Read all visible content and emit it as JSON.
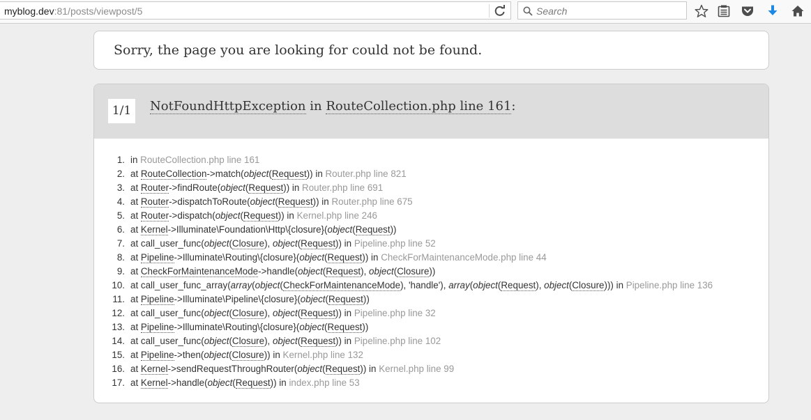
{
  "browser": {
    "url_host": "myblog.dev",
    "url_rest": ":81/posts/viewpost/5",
    "search_placeholder": "Search",
    "icons": [
      "reload-icon",
      "search-icon",
      "bookmark-star-icon",
      "reading-list-icon",
      "pocket-icon",
      "download-icon",
      "home-icon"
    ],
    "colors": {
      "download": "#1e88e5",
      "icon": "#4d4d4d"
    }
  },
  "page": {
    "message": "Sorry, the page you are looking for could not be found.",
    "exception": {
      "counter": "1/1",
      "class_name": "NotFoundHttpException",
      "in_word": " in ",
      "location": "RouteCollection.php line 161",
      "suffix": ":"
    },
    "trace": [
      {
        "n": "1.",
        "parts": [
          {
            "t": "in "
          },
          {
            "t": "RouteCollection.php line 161",
            "c": "loc"
          }
        ]
      },
      {
        "n": "2.",
        "parts": [
          {
            "t": "at "
          },
          {
            "t": "RouteCollection",
            "c": "ab"
          },
          {
            "t": "->match("
          },
          {
            "t": "object",
            "c": "it"
          },
          {
            "t": "("
          },
          {
            "t": "Request",
            "c": "ab"
          },
          {
            "t": ")) in "
          },
          {
            "t": "Router.php line 821",
            "c": "loc"
          }
        ]
      },
      {
        "n": "3.",
        "parts": [
          {
            "t": "at "
          },
          {
            "t": "Router",
            "c": "ab"
          },
          {
            "t": "->findRoute("
          },
          {
            "t": "object",
            "c": "it"
          },
          {
            "t": "("
          },
          {
            "t": "Request",
            "c": "ab"
          },
          {
            "t": ")) in "
          },
          {
            "t": "Router.php line 691",
            "c": "loc"
          }
        ]
      },
      {
        "n": "4.",
        "parts": [
          {
            "t": "at "
          },
          {
            "t": "Router",
            "c": "ab"
          },
          {
            "t": "->dispatchToRoute("
          },
          {
            "t": "object",
            "c": "it"
          },
          {
            "t": "("
          },
          {
            "t": "Request",
            "c": "ab"
          },
          {
            "t": ")) in "
          },
          {
            "t": "Router.php line 675",
            "c": "loc"
          }
        ]
      },
      {
        "n": "5.",
        "parts": [
          {
            "t": "at "
          },
          {
            "t": "Router",
            "c": "ab"
          },
          {
            "t": "->dispatch("
          },
          {
            "t": "object",
            "c": "it"
          },
          {
            "t": "("
          },
          {
            "t": "Request",
            "c": "ab"
          },
          {
            "t": ")) in "
          },
          {
            "t": "Kernel.php line 246",
            "c": "loc"
          }
        ]
      },
      {
        "n": "6.",
        "parts": [
          {
            "t": "at "
          },
          {
            "t": "Kernel",
            "c": "ab"
          },
          {
            "t": "->Illuminate\\Foundation\\Http\\{closure}("
          },
          {
            "t": "object",
            "c": "it"
          },
          {
            "t": "("
          },
          {
            "t": "Request",
            "c": "ab"
          },
          {
            "t": "))"
          }
        ]
      },
      {
        "n": "7.",
        "parts": [
          {
            "t": "at call_user_func("
          },
          {
            "t": "object",
            "c": "it"
          },
          {
            "t": "("
          },
          {
            "t": "Closure",
            "c": "ab"
          },
          {
            "t": "), "
          },
          {
            "t": "object",
            "c": "it"
          },
          {
            "t": "("
          },
          {
            "t": "Request",
            "c": "ab"
          },
          {
            "t": ")) in "
          },
          {
            "t": "Pipeline.php line 52",
            "c": "loc"
          }
        ]
      },
      {
        "n": "8.",
        "parts": [
          {
            "t": "at "
          },
          {
            "t": "Pipeline",
            "c": "ab"
          },
          {
            "t": "->Illuminate\\Routing\\{closure}("
          },
          {
            "t": "object",
            "c": "it"
          },
          {
            "t": "("
          },
          {
            "t": "Request",
            "c": "ab"
          },
          {
            "t": ")) in "
          },
          {
            "t": "CheckForMaintenanceMode.php line 44",
            "c": "loc"
          }
        ]
      },
      {
        "n": "9.",
        "parts": [
          {
            "t": "at "
          },
          {
            "t": "CheckForMaintenanceMode",
            "c": "ab"
          },
          {
            "t": "->handle("
          },
          {
            "t": "object",
            "c": "it"
          },
          {
            "t": "("
          },
          {
            "t": "Request",
            "c": "ab"
          },
          {
            "t": "), "
          },
          {
            "t": "object",
            "c": "it"
          },
          {
            "t": "("
          },
          {
            "t": "Closure",
            "c": "ab"
          },
          {
            "t": "))"
          }
        ]
      },
      {
        "n": "10.",
        "parts": [
          {
            "t": "at call_user_func_array("
          },
          {
            "t": "array",
            "c": "it"
          },
          {
            "t": "("
          },
          {
            "t": "object",
            "c": "it"
          },
          {
            "t": "("
          },
          {
            "t": "CheckForMaintenanceMode",
            "c": "ab"
          },
          {
            "t": "), 'handle'), "
          },
          {
            "t": "array",
            "c": "it"
          },
          {
            "t": "("
          },
          {
            "t": "object",
            "c": "it"
          },
          {
            "t": "("
          },
          {
            "t": "Request",
            "c": "ab"
          },
          {
            "t": "), "
          },
          {
            "t": "object",
            "c": "it"
          },
          {
            "t": "("
          },
          {
            "t": "Closure",
            "c": "ab"
          },
          {
            "t": "))) in "
          },
          {
            "t": "Pipeline.php line 136",
            "c": "loc"
          }
        ]
      },
      {
        "n": "11.",
        "parts": [
          {
            "t": "at "
          },
          {
            "t": "Pipeline",
            "c": "ab"
          },
          {
            "t": "->Illuminate\\Pipeline\\{closure}("
          },
          {
            "t": "object",
            "c": "it"
          },
          {
            "t": "("
          },
          {
            "t": "Request",
            "c": "ab"
          },
          {
            "t": "))"
          }
        ]
      },
      {
        "n": "12.",
        "parts": [
          {
            "t": "at call_user_func("
          },
          {
            "t": "object",
            "c": "it"
          },
          {
            "t": "("
          },
          {
            "t": "Closure",
            "c": "ab"
          },
          {
            "t": "), "
          },
          {
            "t": "object",
            "c": "it"
          },
          {
            "t": "("
          },
          {
            "t": "Request",
            "c": "ab"
          },
          {
            "t": ")) in "
          },
          {
            "t": "Pipeline.php line 32",
            "c": "loc"
          }
        ]
      },
      {
        "n": "13.",
        "parts": [
          {
            "t": "at "
          },
          {
            "t": "Pipeline",
            "c": "ab"
          },
          {
            "t": "->Illuminate\\Routing\\{closure}("
          },
          {
            "t": "object",
            "c": "it"
          },
          {
            "t": "("
          },
          {
            "t": "Request",
            "c": "ab"
          },
          {
            "t": "))"
          }
        ]
      },
      {
        "n": "14.",
        "parts": [
          {
            "t": "at call_user_func("
          },
          {
            "t": "object",
            "c": "it"
          },
          {
            "t": "("
          },
          {
            "t": "Closure",
            "c": "ab"
          },
          {
            "t": "), "
          },
          {
            "t": "object",
            "c": "it"
          },
          {
            "t": "("
          },
          {
            "t": "Request",
            "c": "ab"
          },
          {
            "t": ")) in "
          },
          {
            "t": "Pipeline.php line 102",
            "c": "loc"
          }
        ]
      },
      {
        "n": "15.",
        "parts": [
          {
            "t": "at "
          },
          {
            "t": "Pipeline",
            "c": "ab"
          },
          {
            "t": "->then("
          },
          {
            "t": "object",
            "c": "it"
          },
          {
            "t": "("
          },
          {
            "t": "Closure",
            "c": "ab"
          },
          {
            "t": ")) in "
          },
          {
            "t": "Kernel.php line 132",
            "c": "loc"
          }
        ]
      },
      {
        "n": "16.",
        "parts": [
          {
            "t": "at "
          },
          {
            "t": "Kernel",
            "c": "ab"
          },
          {
            "t": "->sendRequestThroughRouter("
          },
          {
            "t": "object",
            "c": "it"
          },
          {
            "t": "("
          },
          {
            "t": "Request",
            "c": "ab"
          },
          {
            "t": ")) in "
          },
          {
            "t": "Kernel.php line 99",
            "c": "loc"
          }
        ]
      },
      {
        "n": "17.",
        "parts": [
          {
            "t": "at "
          },
          {
            "t": "Kernel",
            "c": "ab"
          },
          {
            "t": "->handle("
          },
          {
            "t": "object",
            "c": "it"
          },
          {
            "t": "("
          },
          {
            "t": "Request",
            "c": "ab"
          },
          {
            "t": ")) in "
          },
          {
            "t": "index.php line 53",
            "c": "loc"
          }
        ]
      }
    ]
  }
}
